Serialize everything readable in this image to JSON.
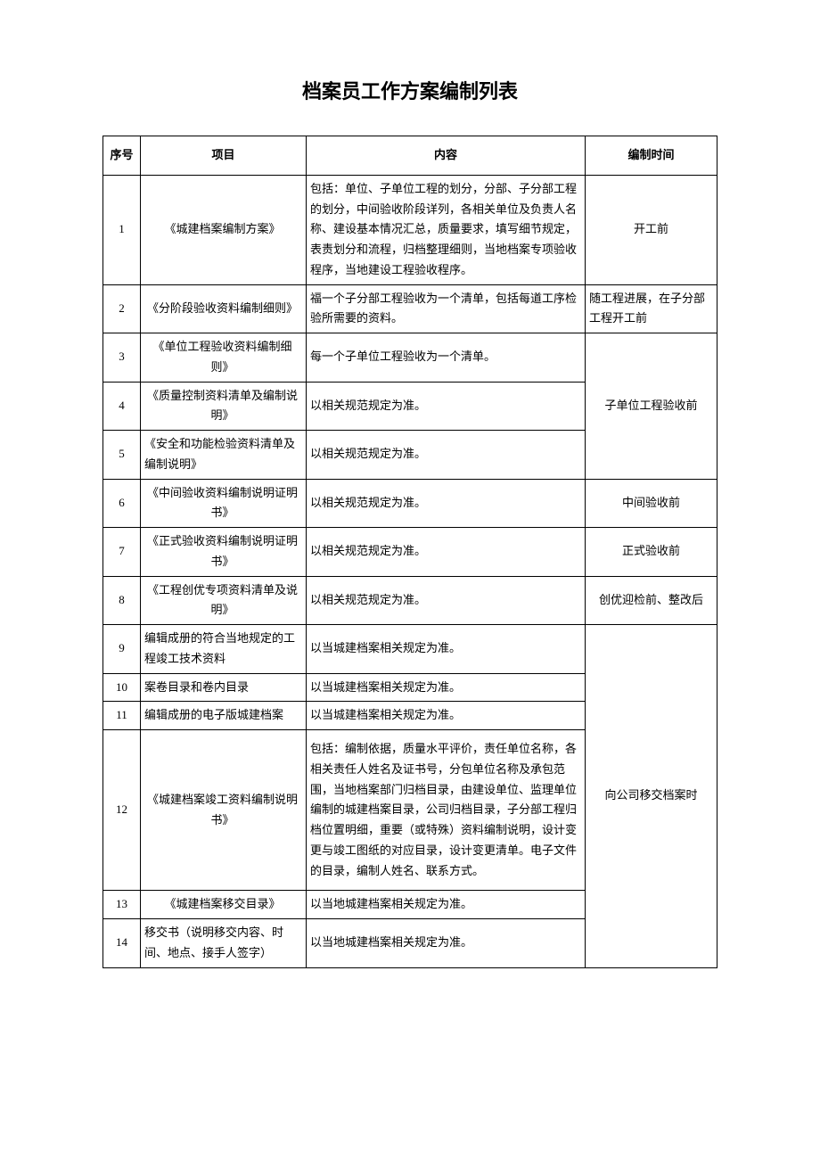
{
  "title": "档案员工作方案编制列表",
  "headers": {
    "seq": "序号",
    "item": "项目",
    "content": "内容",
    "time": "编制时间"
  },
  "rows": {
    "r1": {
      "seq": "1",
      "item": "《城建档案编制方案》",
      "content": "包括：单位、子单位工程的划分，分部、子分部工程的划分，中间验收阶段详列，各相关单位及负责人名称、建设基本情况汇总，质量要求，填写细节规定，表责划分和流程，归档整理细则，当地档案专项验收程序，当地建设工程验收程序。",
      "time": "开工前"
    },
    "r2": {
      "seq": "2",
      "item": "《分阶段验收资料编制细则》",
      "content": "福一个子分部工程验收为一个清单，包括每道工序检验所需要的资料。",
      "time": "随工程进展，在子分部工程开工前"
    },
    "r3": {
      "seq": "3",
      "item": "《单位工程验收资料编制细则》",
      "content": "每一个子单位工程验收为一个清单。"
    },
    "r4": {
      "seq": "4",
      "item": "《质量控制资料清单及编制说明》",
      "content": "以相关规范规定为准。"
    },
    "r5": {
      "seq": "5",
      "item": "《安全和功能检验资料清单及编制说明》",
      "content": "以相关规范规定为准。"
    },
    "time_3_5": "子单位工程验收前",
    "r6": {
      "seq": "6",
      "item": "《中间验收资料编制说明证明书》",
      "content": "以相关规范规定为准。",
      "time": "中间验收前"
    },
    "r7": {
      "seq": "7",
      "item": "《正式验收资料编制说明证明书》",
      "content": "以相关规范规定为准。",
      "time": "正式验收前"
    },
    "r8": {
      "seq": "8",
      "item": "《工程创优专项资料清单及说明》",
      "content": "以相关规范规定为准。",
      "time": "创优迎检前、整改后"
    },
    "r9": {
      "seq": "9",
      "item": "编辑成册的符合当地规定的工程竣工技术资料",
      "content": "以当城建档案相关规定为准。"
    },
    "r10": {
      "seq": "10",
      "item": "案卷目录和卷内目录",
      "content": "以当城建档案相关规定为准。"
    },
    "r11": {
      "seq": "11",
      "item": "编辑成册的电子版城建档案",
      "content": "以当城建档案相关规定为准。"
    },
    "r12": {
      "seq": "12",
      "item": "《城建档案竣工资料编制说明书》",
      "content": "包括：编制依据，质量水平评价，责任单位名称，各相关责任人姓名及证书号，分包单位名称及承包范围，当地档案部门归档目录，由建设单位、监理单位编制的城建档案目录，公司归档目录，子分部工程归档位置明细，重要（或特殊）资料编制说明，设计变更与竣工图纸的对应目录，设计变更清单。电子文件的目录，编制人姓名、联系方式。"
    },
    "time_9_14": "向公司移交档案时",
    "r13": {
      "seq": "13",
      "item": "《城建档案移交目录》",
      "content": "以当地城建档案相关规定为准。"
    },
    "r14": {
      "seq": "14",
      "item": "移交书（说明移交内容、时间、地点、接手人签字）",
      "content": "以当地城建档案相关规定为准。"
    }
  }
}
